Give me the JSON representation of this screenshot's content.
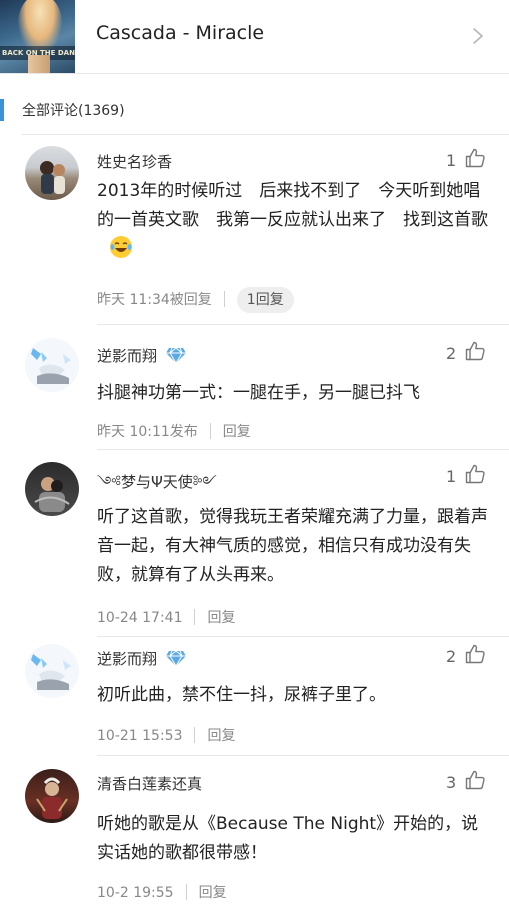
{
  "song": {
    "cover_text": "BACK ON THE DANCEFLOOR",
    "title": "Cascada - Miracle"
  },
  "section": {
    "label": "全部评论(1369)"
  },
  "comments": [
    {
      "user": "姓史名珍香",
      "likes": "1",
      "text": "2013年的时候听过　后来找不到了　今天听到她唱的一首英文歌　我第一反应就认出来了　找到这首歌",
      "time": "昨天 11:34被回复",
      "reply_label": "1回复",
      "emoji": "laughing-tears"
    },
    {
      "user": "逆影而翔",
      "likes": "2",
      "text": "抖腿神功第一式：一腿在手，另一腿已抖飞",
      "time": "昨天 10:11发布",
      "reply_label": "回复"
    },
    {
      "user": "༺梦与Ψ天使༻",
      "likes": "1",
      "text": "听了这首歌，觉得我玩王者荣耀充满了力量，跟着声音一起，有大神气质的感觉，相信只有成功没有失败，就算有了从头再来。",
      "time": "10-24 17:41",
      "reply_label": "回复"
    },
    {
      "user": "逆影而翔",
      "likes": "2",
      "text": "初听此曲，禁不住一抖，尿裤子里了。",
      "time": "10-21 15:53",
      "reply_label": "回复"
    },
    {
      "user": "清香白莲素还真",
      "likes": "3",
      "text": "听她的歌是从《Because The Night》开始的，说实话她的歌都很带感！",
      "time": "10-2 19:55",
      "reply_label": "回复"
    }
  ],
  "colors": {
    "accent": "#3a93d8",
    "diamond_badge": "#5aa9e6"
  }
}
